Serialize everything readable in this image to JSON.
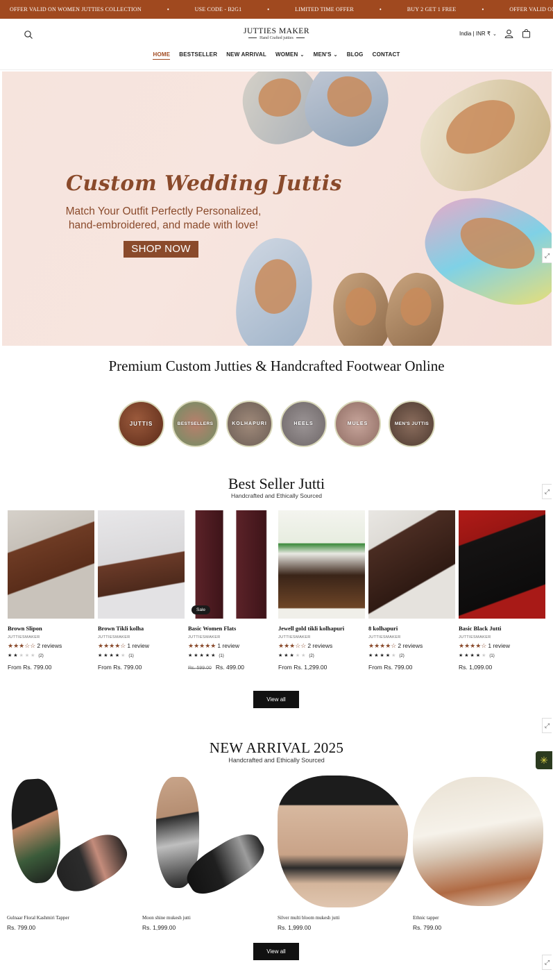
{
  "announcement": {
    "items": [
      "OFFER VALID ON WOMEN JUTTIES COLLECTION",
      "USE CODE - B2G1",
      "LIMITED TIME OFFER",
      "BUY 2 GET 1 FREE",
      "OFFER VALID ON WOMEN JUTTIES COLLI"
    ],
    "separator": "•"
  },
  "header": {
    "logo_title": "JUTTIES MAKER",
    "logo_subtitle": "Hand Crafted jutties",
    "locale": "India | INR ₹",
    "nav": [
      {
        "label": "HOME"
      },
      {
        "label": "BESTSELLER"
      },
      {
        "label": "NEW ARRIVAL"
      },
      {
        "label": "WOMEN"
      },
      {
        "label": "MEN'S"
      },
      {
        "label": "BLOG"
      },
      {
        "label": "CONTACT"
      }
    ]
  },
  "hero": {
    "title": "Custom Wedding Juttis",
    "subtitle_line1": "Match Your Outfit Perfectly Personalized,",
    "subtitle_line2": "hand-embroidered, and made with love!",
    "cta": "SHOP NOW"
  },
  "premium_title": "Premium Custom Jutties & Handcrafted Footwear Online",
  "categories": [
    "JUTTIS",
    "BESTSELLERS",
    "KOLHAPURI",
    "HEELS",
    "MULES",
    "MEN'S JUTTIS"
  ],
  "bestseller": {
    "title": "Best Seller Jutti",
    "subtitle": "Handcrafted and Ethically Sourced",
    "view_all": "View all",
    "products": [
      {
        "name": "Brown Slipon",
        "vendor": "JUTTIESMAKER",
        "stars": "★★★☆☆",
        "reviews": "2 reviews",
        "mini_count": "(2)",
        "price": "From Rs. 799.00",
        "old_price": "",
        "sale": ""
      },
      {
        "name": "Brown Tikli kolha",
        "vendor": "JUTTIESMAKER",
        "stars": "★★★★☆",
        "reviews": "1 review",
        "mini_count": "(1)",
        "price": "From Rs. 799.00",
        "old_price": "",
        "sale": ""
      },
      {
        "name": "Basic Women Flats",
        "vendor": "JUTTIESMAKER",
        "stars": "★★★★★",
        "reviews": "1 review",
        "mini_count": "(1)",
        "price": "Rs. 499.00",
        "old_price": "Rs. 599.00",
        "sale": "Sale"
      },
      {
        "name": "Jewell gold tikli kolhapuri",
        "vendor": "JUTTIESMAKER",
        "stars": "★★★☆☆",
        "reviews": "2 reviews",
        "mini_count": "(2)",
        "price": "From Rs. 1,299.00",
        "old_price": "",
        "sale": ""
      },
      {
        "name": "8 kolhapuri",
        "vendor": "JUTTIESMAKER",
        "stars": "★★★★☆",
        "reviews": "2 reviews",
        "mini_count": "(2)",
        "price": "From Rs. 799.00",
        "old_price": "",
        "sale": ""
      },
      {
        "name": "Basic Black Jutti",
        "vendor": "JUTTIESMAKER",
        "stars": "★★★★☆",
        "reviews": "1 review",
        "mini_count": "(1)",
        "price": "Rs. 1,099.00",
        "old_price": "",
        "sale": ""
      }
    ]
  },
  "new_arrival": {
    "title": "NEW ARRIVAL 2025",
    "subtitle": "Handcrafted and Ethically Sourced",
    "view_all": "View all",
    "products": [
      {
        "name": "Gulnaar Floral Kashmiri Tapper",
        "price": "Rs. 799.00"
      },
      {
        "name": "Moon shine mukesh jutti",
        "price": "Rs. 1,999.00"
      },
      {
        "name": "Silver multi bloom mukesh jutti",
        "price": "Rs. 1,999.00"
      },
      {
        "name": "Ethnic tapper",
        "price": "Rs. 799.00"
      }
    ]
  },
  "colors": {
    "brand": "#a0491f",
    "accent_text": "#8a4a2b",
    "button": "#111111"
  }
}
